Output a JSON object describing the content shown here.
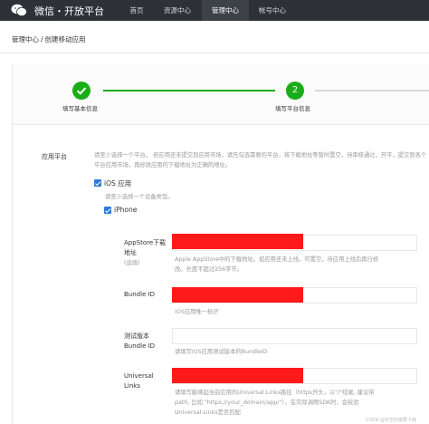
{
  "header": {
    "logo_text": "微信・开放平台",
    "nav": [
      {
        "label": "首页"
      },
      {
        "label": "资源中心"
      },
      {
        "label": "管理中心"
      },
      {
        "label": "帐号中心"
      }
    ]
  },
  "breadcrumb": {
    "parent": "管理中心",
    "separator": "/",
    "current": "创建移动应用"
  },
  "steps": [
    {
      "number": "",
      "label": "填写基本信息",
      "status": "done"
    },
    {
      "number": "2",
      "label": "填写平台信息",
      "status": "current"
    }
  ],
  "form": {
    "platform_label": "应用平台",
    "platform_hint": "请至少选择一个平台。 若应用还未提交到应用市场，请先勾选需要的平台，将下载地址等暂时置空，待审核通过，开平，提交到各个平台应用市场，再修改应用的下载地址为正确的地址。",
    "ios": {
      "label": "iOS 应用",
      "hint": "请至少选择一个设备类型。",
      "iphone_label": "iPhone"
    },
    "fields": [
      {
        "label": "AppStore下载地址",
        "sublabel": "(选填)",
        "hint_line1": "Apple AppStore中的下载地址。如应用还未上线，可置空，待应用上线后再行修",
        "hint_line2": "改。长度不超过256字节。"
      },
      {
        "label": "Bundle ID",
        "hint_line1": "iOS应用唯一标识"
      },
      {
        "label_line1": "测试版本",
        "label_line2": "Bundle ID",
        "hint_line1": "请填写iOS应用测试版本的BundleID"
      },
      {
        "label_line1": "Universal",
        "label_line2": "Links",
        "hint_line1": "请填写能唤起当前应用的Universal Links路径（https开头，以\"/\"结尾, 建议带",
        "hint_line2": "path, 比如 \"https://your_domain/app/\"），在实际调用SDK时，会校验",
        "hint_line3": "Universal Links是否匹配"
      }
    ]
  },
  "watermark": "CSDN @天空好像要下雨",
  "colors": {
    "topbar": "#2e3238",
    "accent_green": "#1aad19",
    "checkbox_blue": "#2b7bd9",
    "redaction": "#ff1a1a"
  }
}
